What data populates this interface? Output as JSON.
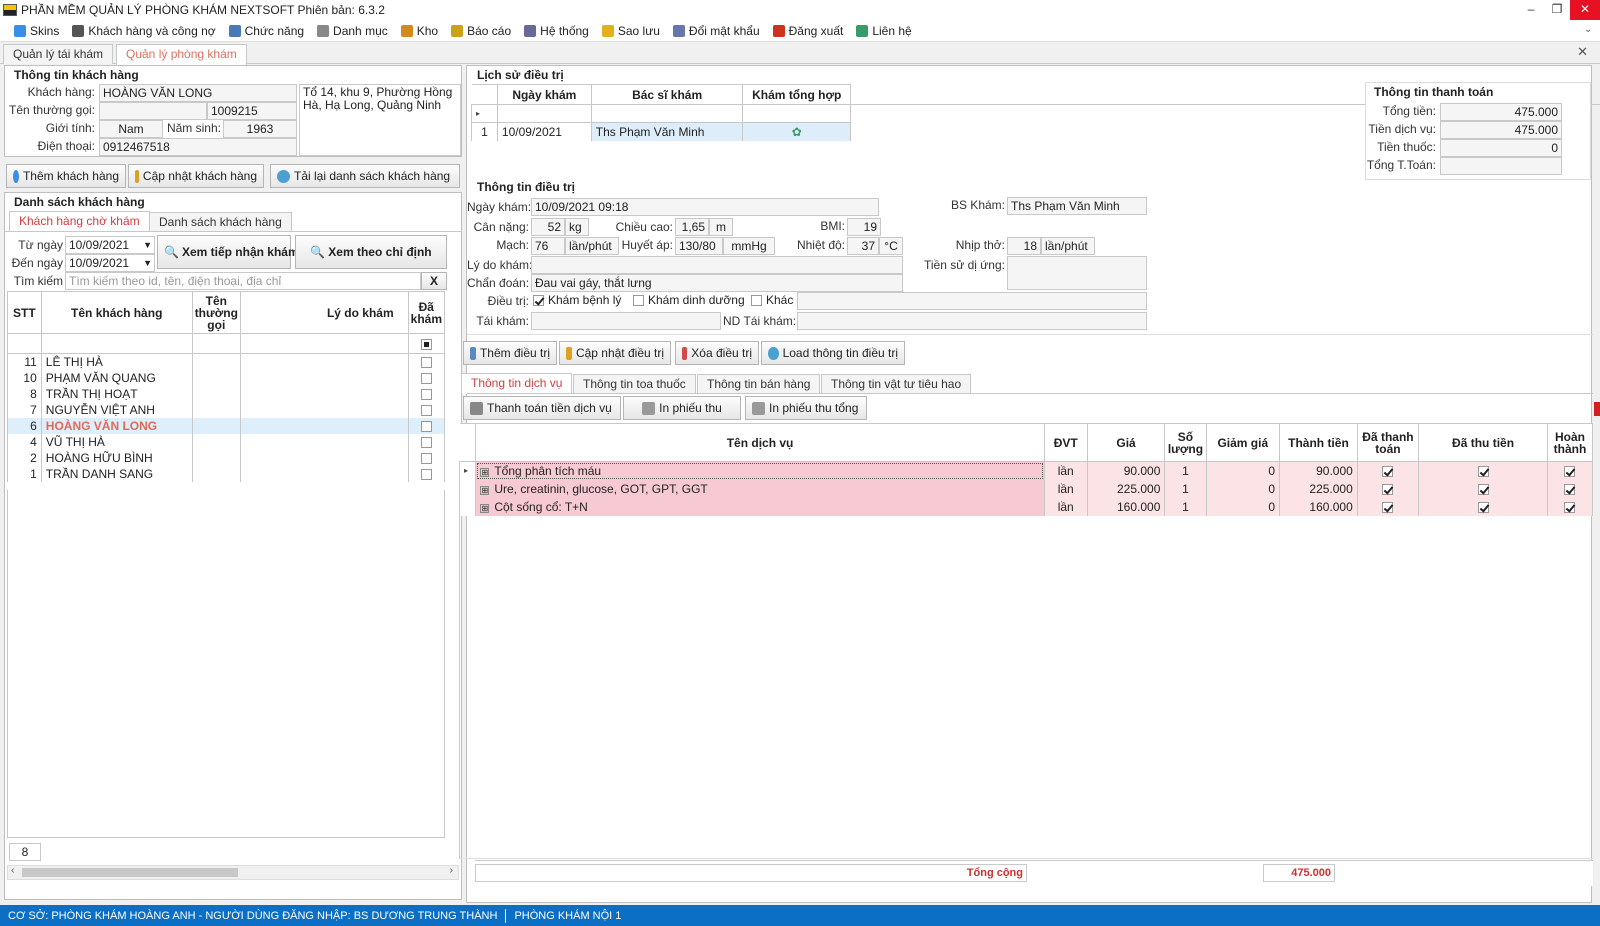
{
  "app": {
    "title": "PHẦN MỀM QUẢN LÝ PHÒNG KHÁM NEXTSOFT Phiên bản: 6.3.2"
  },
  "menu": [
    {
      "label": "Skins",
      "icon": "palette-icon",
      "color": "#3a8ee6"
    },
    {
      "label": "Khách hàng và công nợ",
      "icon": "user-icon",
      "color": "#555555"
    },
    {
      "label": "Chức năng",
      "icon": "window-icon",
      "color": "#4a7ab5"
    },
    {
      "label": "Danh mục",
      "icon": "list-icon",
      "color": "#888888"
    },
    {
      "label": "Kho",
      "icon": "box-icon",
      "color": "#d08a20"
    },
    {
      "label": "Báo cáo",
      "icon": "report-icon",
      "color": "#c9a21a"
    },
    {
      "label": "Hệ thống",
      "icon": "gear-icon",
      "color": "#6a6a9a"
    },
    {
      "label": "Sao lưu",
      "icon": "database-icon",
      "color": "#e0b020"
    },
    {
      "label": "Đổi mật khẩu",
      "icon": "key-icon",
      "color": "#6677aa"
    },
    {
      "label": "Đăng xuất",
      "icon": "logout-icon",
      "color": "#d03020"
    },
    {
      "label": "Liên hệ",
      "icon": "contact-icon",
      "color": "#3a9a6a"
    }
  ],
  "tabs": {
    "t1": "Quản lý tái khám",
    "t2": "Quản lý phòng khám"
  },
  "customer": {
    "section": "Thông tin khách hàng",
    "name_label": "Khách hàng:",
    "name": "HOÀNG VĂN LONG",
    "alias_label": "Tên thường gọi:",
    "alias": "",
    "code": "1009215",
    "gender_label": "Giới tính:",
    "gender": "Nam",
    "birth_label": "Năm sinh:",
    "birth": "1963",
    "phone_label": "Điện thoại:",
    "phone": "0912467518",
    "address": "Tổ 14, khu 9, Phường Hồng Hà, Hạ Long, Quảng Ninh"
  },
  "cust_buttons": {
    "add": "Thêm khách hàng",
    "update": "Cập nhật khách hàng",
    "reload": "Tải lại danh sách khách hàng"
  },
  "list": {
    "section": "Danh sách khách hàng",
    "tab_wait": "Khách hàng chờ khám",
    "tab_all": "Danh sách khách hàng",
    "from_label": "Từ ngày",
    "from": "10/09/2021",
    "to_label": "Đến ngày",
    "to": "10/09/2021",
    "btn_receive": "Xem tiếp nhận khám",
    "btn_indication": "Xem theo chỉ định",
    "search_label": "Tìm kiếm",
    "search_placeholder": "Tìm kiếm theo id, tên, điện thoại, địa chỉ",
    "clear": "X",
    "headers": {
      "stt": "STT",
      "name": "Tên khách hàng",
      "alias": "Tên thường gọi",
      "reason": "Lý do khám",
      "done": "Đã khám"
    },
    "rows": [
      {
        "stt": "11",
        "name": "LÊ THỊ HÀ"
      },
      {
        "stt": "10",
        "name": "PHẠM VĂN QUANG"
      },
      {
        "stt": "8",
        "name": "TRẦN THỊ HOẠT"
      },
      {
        "stt": "7",
        "name": "NGUYỄN VIỆT ANH"
      },
      {
        "stt": "6",
        "name": "HOÀNG VĂN LONG"
      },
      {
        "stt": "4",
        "name": "VŨ THỊ HÀ"
      },
      {
        "stt": "2",
        "name": "HOÀNG HỮU BÌNH"
      },
      {
        "stt": "1",
        "name": "TRẦN DANH SANG"
      }
    ],
    "count": "8"
  },
  "history": {
    "section": "Lịch sử điều trị",
    "headers": {
      "date": "Ngày khám",
      "doctor": "Bác sĩ khám",
      "summary": "Khám tổng hợp"
    },
    "rows": [
      {
        "no": "1",
        "date": "10/09/2021",
        "doctor": "Ths Phạm Văn Minh"
      }
    ]
  },
  "payment": {
    "section": "Thông tin thanh toán",
    "total_label": "Tổng tiền:",
    "total": "475.000",
    "service_label": "Tiền dịch vụ:",
    "service": "475.000",
    "drug_label": "Tiền thuốc:",
    "drug": "0",
    "paid_label": "Tổng T.Toán:",
    "paid": ""
  },
  "treatment": {
    "section": "Thông tin điều trị",
    "date_label": "Ngày khám:",
    "date": "10/09/2021 09:18",
    "doctor_label": "BS Khám:",
    "doctor": "Ths Phạm Văn Minh",
    "weight_label": "Cân nặng:",
    "weight": "52",
    "weight_unit": "kg",
    "height_label": "Chiều cao:",
    "height": "1,65",
    "height_unit": "m",
    "bmi_label": "BMI:",
    "bmi": "19",
    "pulse_label": "Mạch:",
    "pulse": "76",
    "pulse_unit": "lần/phút",
    "bp_label": "Huyết áp:",
    "bp": "130/80",
    "bp_unit": "mmHg",
    "temp_label": "Nhiệt độ:",
    "temp": "37",
    "temp_unit": "°C",
    "breath_label": "Nhịp thở:",
    "breath": "18",
    "breath_unit": "lần/phút",
    "reason_label": "Lý do khám:",
    "reason": "",
    "allergy_label": "Tiền sử dị ứng:",
    "allergy": "",
    "diag_label": "Chẩn đoán:",
    "diag": "Đau vai gáy, thắt lưng",
    "treat_label": "Điều trị:",
    "opt1": "Khám bệnh lý",
    "opt2": "Khám dinh dưỡng",
    "opt3": "Khác",
    "revisit_label": "Tái khám:",
    "revisit": "",
    "revisit_note_label": "ND Tái khám:",
    "revisit_note": ""
  },
  "treat_buttons": {
    "add": "Thêm điều trị",
    "update": "Cập nhật điều trị",
    "delete": "Xóa điều trị",
    "load": "Load thông tin điều trị"
  },
  "subtabs": {
    "s1": "Thông tin dịch vụ",
    "s2": "Thông tin toa thuốc",
    "s3": "Thông tin bán hàng",
    "s4": "Thông tin vật tư tiêu hao"
  },
  "svc_buttons": {
    "pay": "Thanh toán tiền dịch vụ",
    "print": "In phiếu thu",
    "print_total": "In phiếu thu tổng"
  },
  "services": {
    "headers": {
      "name": "Tên dịch vụ",
      "unit": "ĐVT",
      "price": "Giá",
      "qty": "Số lượng",
      "discount": "Giảm giá",
      "amount": "Thành tiền",
      "paid": "Đã thanh toán",
      "collected": "Đã thu tiền",
      "done": "Hoàn thành"
    },
    "rows": [
      {
        "name": "Tổng phân tích máu",
        "unit": "lần",
        "price": "90.000",
        "qty": "1",
        "discount": "0",
        "amount": "90.000"
      },
      {
        "name": "Ure, creatinin, glucose, GOT, GPT, GGT",
        "unit": "lần",
        "price": "225.000",
        "qty": "1",
        "discount": "0",
        "amount": "225.000"
      },
      {
        "name": "Cột sống cổ: T+N",
        "unit": "lần",
        "price": "160.000",
        "qty": "1",
        "discount": "0",
        "amount": "160.000"
      }
    ],
    "total_label": "Tổng cộng",
    "total": "475.000"
  },
  "status": {
    "left": "CƠ SỞ: PHÒNG KHÁM HOÀNG ANH - NGƯỜI DÙNG ĐĂNG NHẬP: BS DƯƠNG TRUNG THÀNH",
    "right": "PHÒNG KHÁM NỘI 1"
  }
}
